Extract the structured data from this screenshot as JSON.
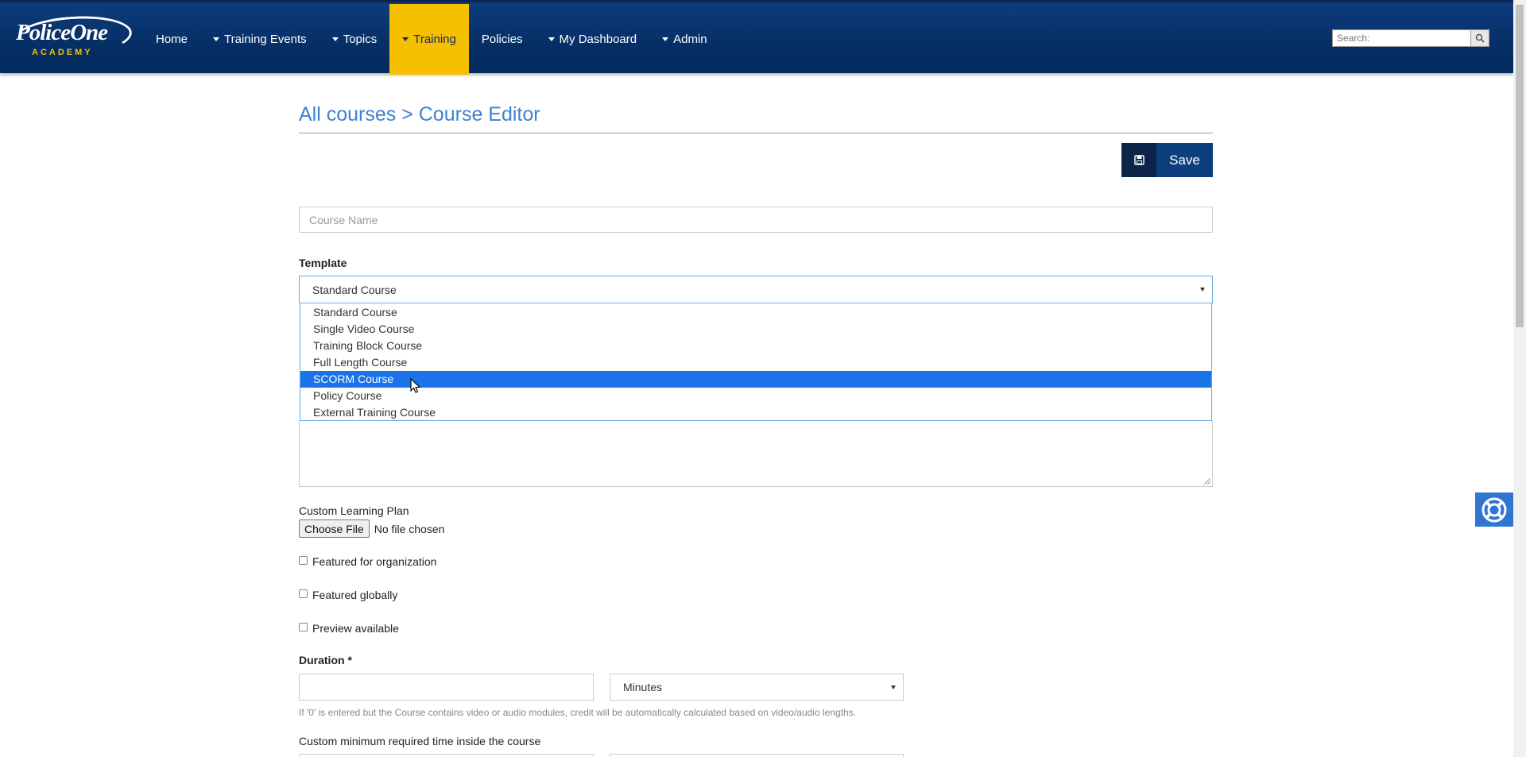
{
  "header": {
    "logo_text": "PoliceOne",
    "logo_sub": "ACADEMY",
    "nav": [
      {
        "label": "Home",
        "dropdown": false,
        "active": false
      },
      {
        "label": "Training Events",
        "dropdown": true,
        "active": false
      },
      {
        "label": "Topics",
        "dropdown": true,
        "active": false
      },
      {
        "label": "Training",
        "dropdown": true,
        "active": true
      },
      {
        "label": "Policies",
        "dropdown": false,
        "active": false
      },
      {
        "label": "My Dashboard",
        "dropdown": true,
        "active": false
      },
      {
        "label": "Admin",
        "dropdown": true,
        "active": false
      }
    ],
    "search_placeholder": "Search:",
    "accent_active": "#f6bf00"
  },
  "page": {
    "breadcrumb": "All courses > Course Editor",
    "save_label": "Save",
    "course_name_placeholder": "Course Name",
    "template_label": "Template",
    "template_value": "Standard Course",
    "template_options": [
      "Standard Course",
      "Single Video Course",
      "Training Block Course",
      "Full Length Course",
      "SCORM Course",
      "Policy Course",
      "External Training Course"
    ],
    "highlighted_option": "SCORM Course",
    "learning_plan_label": "Custom Learning Plan",
    "choose_file_label": "Choose File",
    "file_status": "No file chosen",
    "checkboxes": [
      {
        "label": "Featured for organization",
        "checked": false
      },
      {
        "label": "Featured globally",
        "checked": false
      },
      {
        "label": "Preview available",
        "checked": false
      }
    ],
    "duration_label": "Duration *",
    "duration_units": "Minutes",
    "duration_help": "If '0' is entered but the Course contains video or audio modules, credit will be automatically calculated based on video/audio lengths.",
    "min_time_label": "Custom minimum required time inside the course"
  }
}
